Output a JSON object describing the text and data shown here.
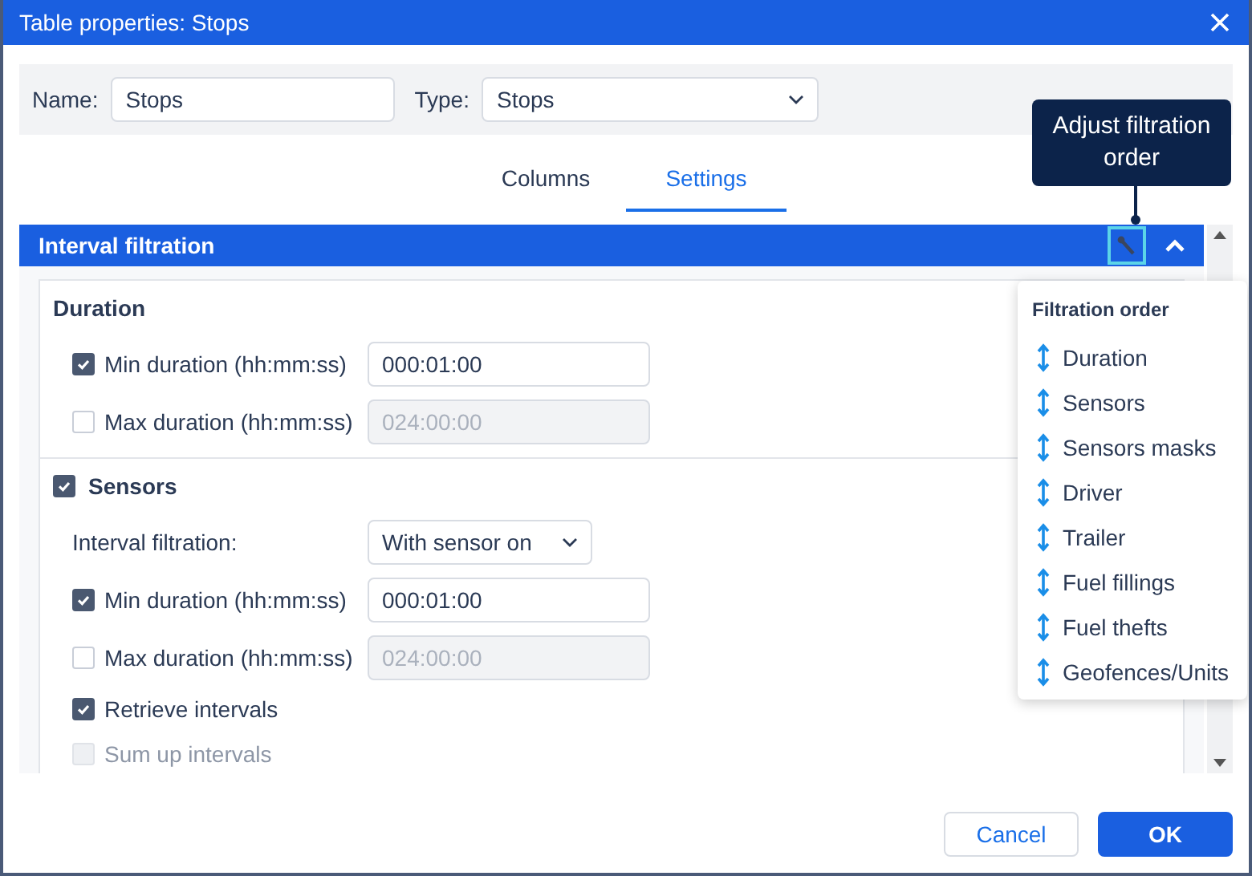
{
  "window": {
    "title": "Table properties: Stops"
  },
  "name_field": {
    "label": "Name:",
    "value": "Stops"
  },
  "type_field": {
    "label": "Type:",
    "value": "Stops"
  },
  "tabs": [
    {
      "label": "Columns",
      "selected": false
    },
    {
      "label": "Settings",
      "selected": true
    }
  ],
  "section": {
    "title": "Interval filtration",
    "expanded": true
  },
  "groups": [
    {
      "title": "Duration",
      "rows": [
        {
          "kind": "checkbox-field",
          "label": "Min duration (hh:mm:ss)",
          "checked": true,
          "value": "000:01:00",
          "field_disabled": false
        },
        {
          "kind": "checkbox-field",
          "label": "Max duration (hh:mm:ss)",
          "checked": false,
          "value": "024:00:00",
          "field_disabled": true
        }
      ]
    },
    {
      "title": "Sensors",
      "checked": true,
      "rows": [
        {
          "kind": "select",
          "label": "Interval filtration:",
          "value": "With sensor on"
        },
        {
          "kind": "checkbox-field",
          "label": "Min duration (hh:mm:ss)",
          "checked": true,
          "value": "000:01:00",
          "field_disabled": false
        },
        {
          "kind": "checkbox-field",
          "label": "Max duration (hh:mm:ss)",
          "checked": false,
          "value": "024:00:00",
          "field_disabled": true
        },
        {
          "kind": "checkbox",
          "label": "Retrieve intervals",
          "checked": true,
          "disabled": false
        },
        {
          "kind": "checkbox",
          "label": "Sum up intervals",
          "checked": false,
          "disabled": true
        }
      ]
    }
  ],
  "tooltip": {
    "text": "Adjust filtration order"
  },
  "filtration_order": {
    "title": "Filtration order",
    "items": [
      "Duration",
      "Sensors",
      "Sensors masks",
      "Driver",
      "Trailer",
      "Fuel fillings",
      "Fuel thefts",
      "Geofences/Units"
    ]
  },
  "buttons": [
    {
      "label": "Cancel",
      "kind": "secondary"
    },
    {
      "label": "OK",
      "kind": "primary"
    }
  ]
}
